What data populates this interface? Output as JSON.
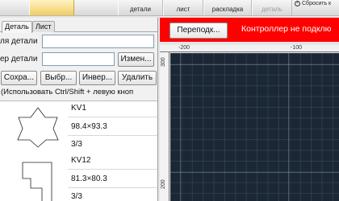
{
  "toolbar": {
    "buttons": [
      {
        "label": "",
        "state": "selected"
      },
      {
        "label": "детали",
        "state": "normal"
      },
      {
        "label": "лист",
        "state": "normal"
      },
      {
        "label": "раскладка",
        "state": "normal"
      },
      {
        "label": "деталь",
        "state": "disabled"
      }
    ],
    "reset_label": "Сбросить к"
  },
  "left_panel": {
    "tabs": [
      "Деталь",
      "Лист"
    ],
    "active_tab": "Деталь",
    "name_label": "ля детали",
    "name_value": "",
    "number_label": "ер детали",
    "number_value": "",
    "change_button": "Измен...",
    "actions": [
      "Сохра...",
      "Выбр...",
      "Инвер...",
      "Удалить"
    ],
    "hint": "(Использовать Ctrl/Shift + левую кноп"
  },
  "parts": [
    {
      "name": "KV1",
      "size": "98.4×93.3",
      "count": "3/3",
      "icon": "star-shape-icon"
    },
    {
      "name": "KV12",
      "size": "81.3×80.3",
      "count": "3/3",
      "icon": "stepped-shape-icon"
    }
  ],
  "status": {
    "reconnect_label": "Переподк...",
    "message": "Контроллер не подклю",
    "color": "#ff0000"
  },
  "rulers": {
    "h_labels": [
      "-200",
      "-100"
    ],
    "v_labels": [
      "300",
      "200"
    ]
  },
  "colors": {
    "canvas_bg": "#1b2734",
    "selected_tool": "#f2cc63"
  }
}
